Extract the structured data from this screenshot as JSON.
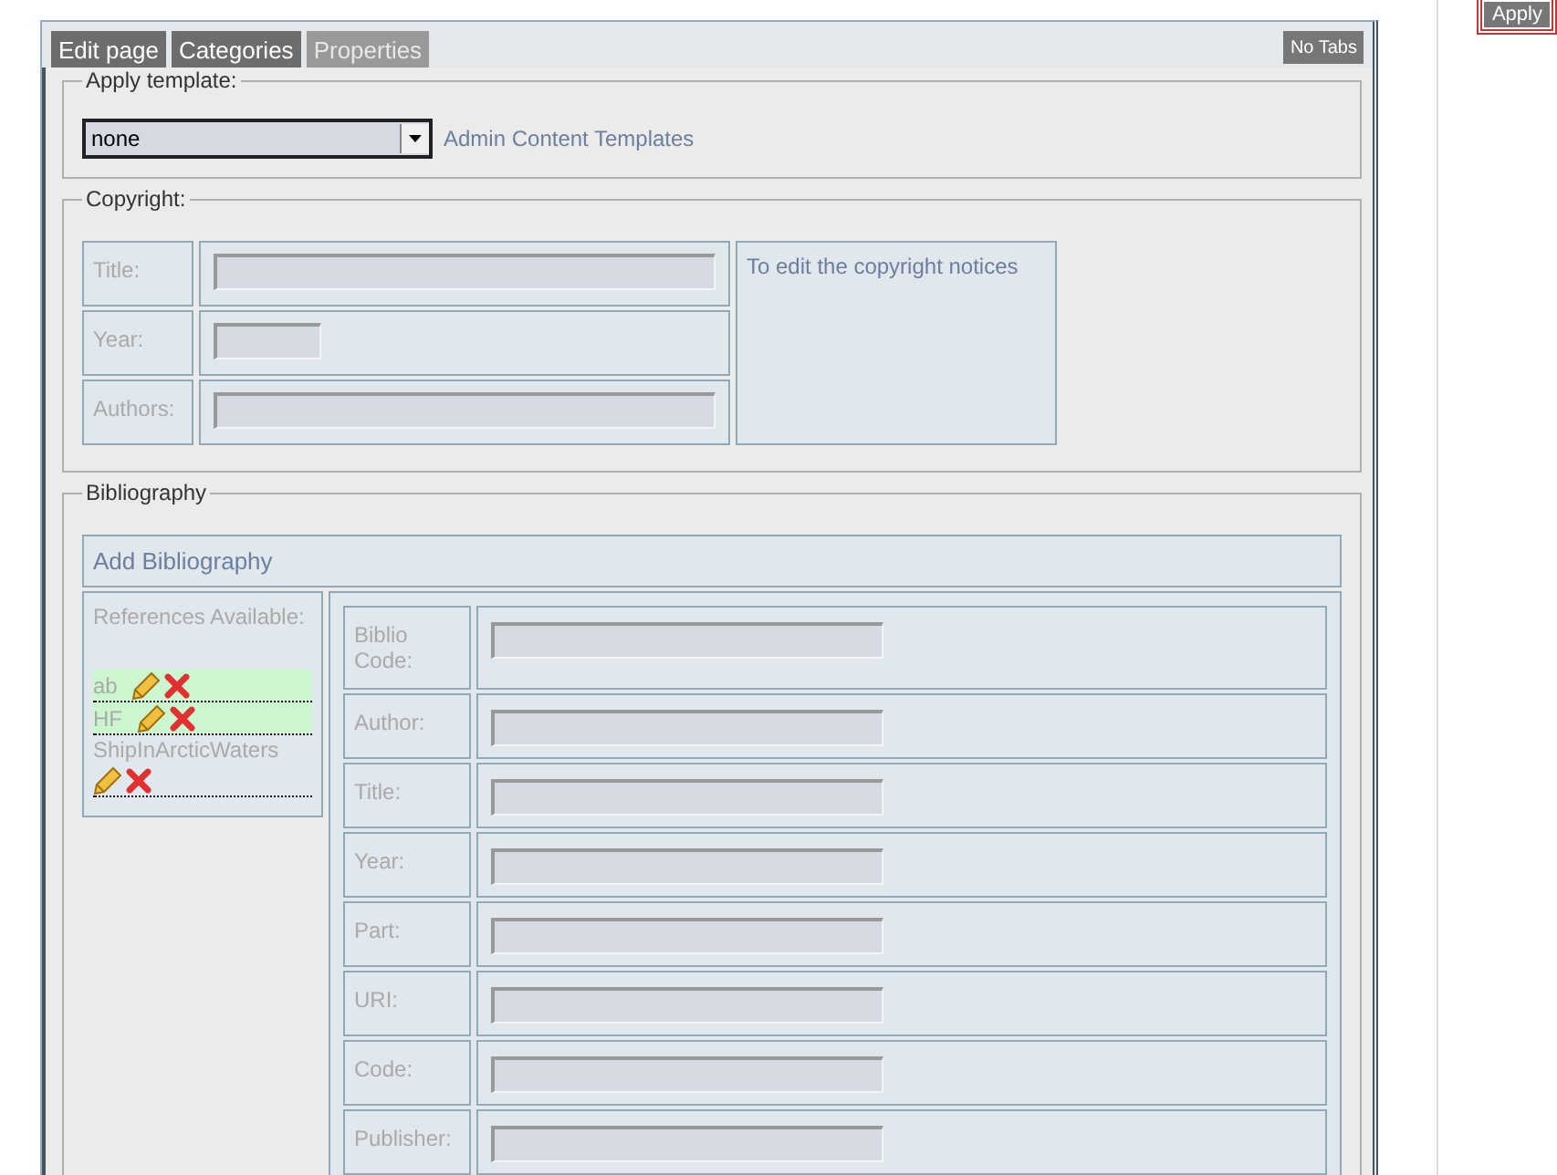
{
  "tabs": [
    {
      "label": "Edit page",
      "selected": false
    },
    {
      "label": "Categories",
      "selected": false
    },
    {
      "label": "Properties",
      "selected": true
    }
  ],
  "no_tabs_button": "No Tabs",
  "apply_button": "Apply",
  "apply_template": {
    "legend": "Apply template:",
    "select_value": "none",
    "link": "Admin Content Templates"
  },
  "copyright": {
    "legend": "Copyright:",
    "fields": [
      {
        "label": "Title:",
        "kind": "long"
      },
      {
        "label": "Year:",
        "kind": "short"
      },
      {
        "label": "Authors:",
        "kind": "long"
      }
    ],
    "note": "To edit the copyright notices"
  },
  "bibliography": {
    "legend": "Bibliography",
    "add_link": "Add Bibliography",
    "references_heading": "References Available:",
    "references": [
      {
        "name": "ab",
        "highlighted": true
      },
      {
        "name": "HF",
        "highlighted": true
      },
      {
        "name": "ShipInArcticWaters",
        "highlighted": false
      }
    ],
    "fields": [
      {
        "label": "Biblio Code:"
      },
      {
        "label": "Author:"
      },
      {
        "label": "Title:"
      },
      {
        "label": "Year:"
      },
      {
        "label": "Part:"
      },
      {
        "label": "URI:"
      },
      {
        "label": "Code:"
      },
      {
        "label": "Publisher:"
      }
    ]
  }
}
